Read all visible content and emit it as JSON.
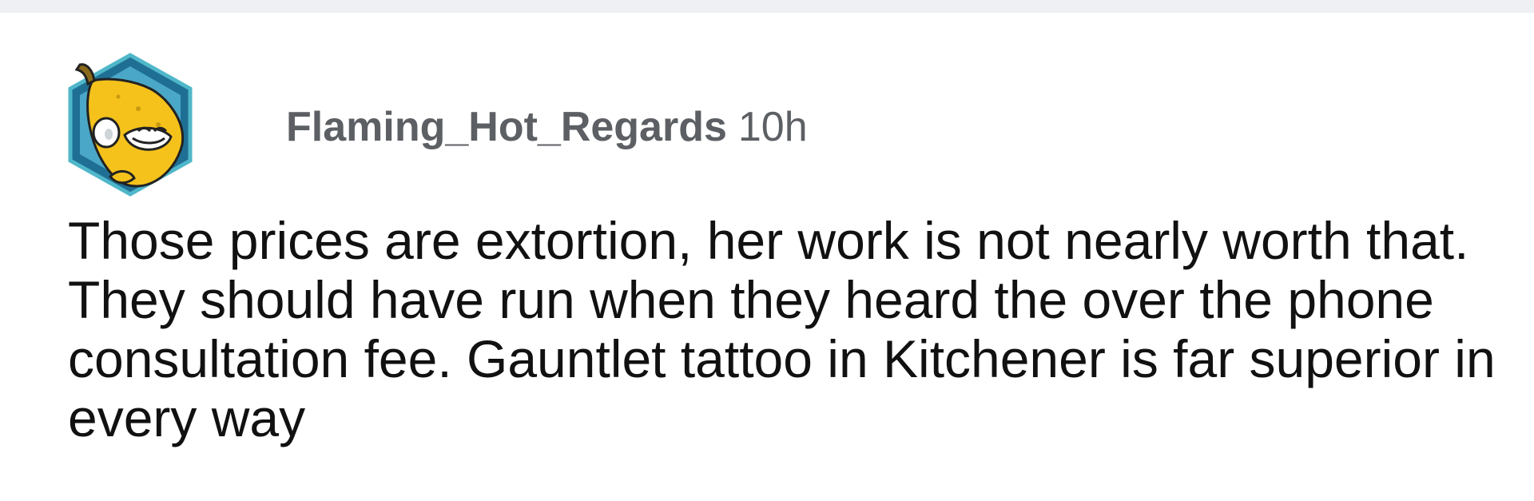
{
  "comment": {
    "username": "Flaming_Hot_Regards",
    "timestamp": "10h",
    "body": "Those prices are extortion, her work is not nearly worth that. They should have run when they heard the over the phone consultation fee. Gauntlet tattoo in Kitchener is far superior in every way"
  },
  "avatar": {
    "icon": "banana-avatar-icon",
    "frame_color": "#2a7fa0",
    "fill_color": "#f5c21b"
  },
  "colors": {
    "meta_text": "#5c5f63",
    "body_text": "#111111",
    "background": "#ffffff",
    "top_strip": "#eef0f3"
  }
}
